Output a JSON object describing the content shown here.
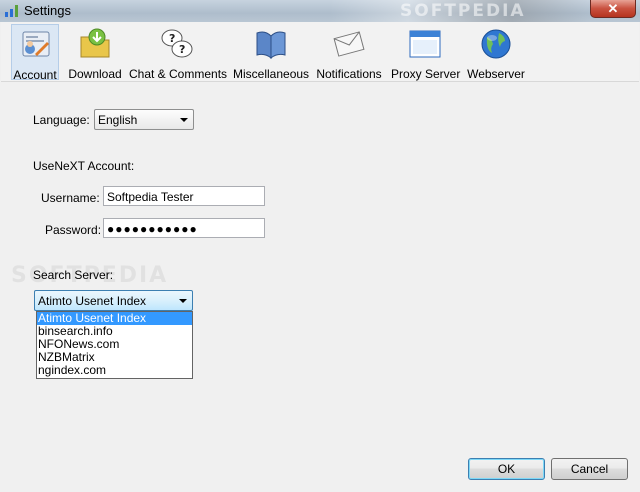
{
  "window": {
    "title": "Settings",
    "close_label": "✕",
    "watermark": "SOFTPEDIA"
  },
  "toolbar": {
    "items": [
      {
        "label": "Account",
        "icon": "account-icon",
        "selected": true
      },
      {
        "label": "Download",
        "icon": "download-folder-icon"
      },
      {
        "label": "Chat & Comments",
        "icon": "chat-bubbles-icon"
      },
      {
        "label": "Miscellaneous",
        "icon": "book-icon"
      },
      {
        "label": "Notifications",
        "icon": "envelope-icon"
      },
      {
        "label": "Proxy Server",
        "icon": "window-icon"
      },
      {
        "label": "Webserver",
        "icon": "globe-icon"
      }
    ]
  },
  "form": {
    "language_label": "Language:",
    "language_value": "English",
    "account_heading": "UseNeXT Account:",
    "username_label": "Username:",
    "username_value": "Softpedia Tester",
    "password_label": "Password:",
    "password_value": "●●●●●●●●●●●",
    "search_server_label": "Search Server:",
    "search_server_value": "Atimto Usenet Index",
    "search_server_options": [
      "Atimto Usenet Index",
      "binsearch.info",
      "NFONews.com",
      "NZBMatrix",
      "ngindex.com"
    ],
    "watermark": "SOFTPEDIA"
  },
  "buttons": {
    "ok_label": "OK",
    "cancel_label": "Cancel"
  },
  "colors": {
    "highlight": "#3399ff",
    "toolbar_selected": "#dbe7f4"
  }
}
